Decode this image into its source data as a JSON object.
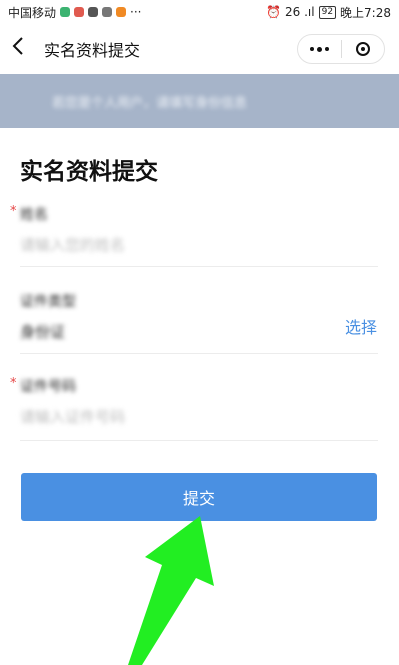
{
  "status_bar": {
    "carrier": "中国移动",
    "right_icons": "⏰ 26 .ıl",
    "battery": "92",
    "time": "晚上7:28"
  },
  "nav": {
    "title": "实名资料提交"
  },
  "banner": {
    "text": "若您是个人用户，请填写身份信息"
  },
  "page": {
    "heading": "实名资料提交"
  },
  "form": {
    "name_label": "姓名",
    "name_placeholder": "请输入您的姓名",
    "id_type_label": "证件类型",
    "id_type_value": "身份证",
    "choose_label": "选择",
    "id_number_label": "证件号码",
    "id_number_placeholder": "请输入证件号码",
    "required_mark": "*"
  },
  "submit_label": "提交",
  "colors": {
    "accent": "#4a90e2",
    "banner_bg": "#a6b4c9",
    "required": "#e54545",
    "arrow": "#22ee22"
  }
}
